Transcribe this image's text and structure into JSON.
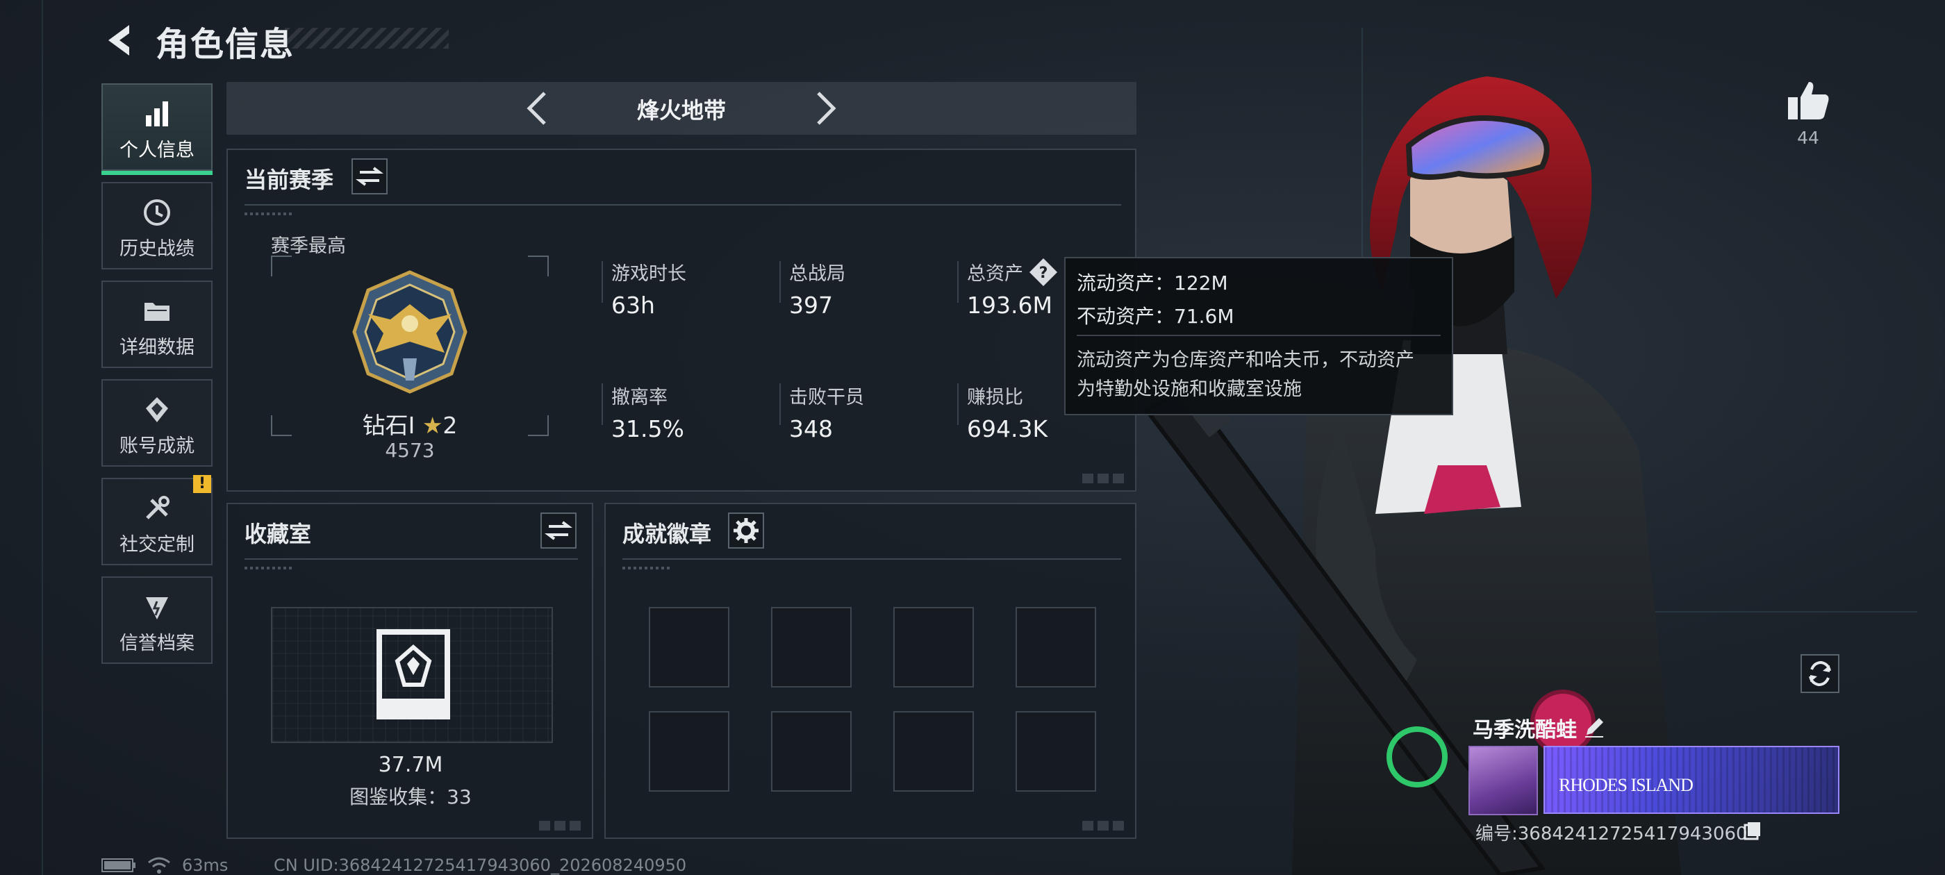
{
  "header": {
    "title": "角色信息"
  },
  "sidebar": {
    "items": [
      {
        "label": "个人信息",
        "icon": "bar-chart-icon",
        "active": true
      },
      {
        "label": "历史战绩",
        "icon": "history-icon",
        "active": false
      },
      {
        "label": "详细数据",
        "icon": "folder-icon",
        "active": false
      },
      {
        "label": "账号成就",
        "icon": "achievement-icon",
        "active": false
      },
      {
        "label": "社交定制",
        "icon": "tools-icon",
        "active": false,
        "badge": "!"
      },
      {
        "label": "信誉档案",
        "icon": "credit-icon",
        "active": false
      }
    ]
  },
  "mode": {
    "title": "烽火地带"
  },
  "season": {
    "title": "当前赛季",
    "best_label": "赛季最高",
    "rank_name": "钻石I",
    "rank_stars": "2",
    "rank_score": "4573",
    "stats": [
      {
        "label": "游戏时长",
        "value": "63h"
      },
      {
        "label": "总战局",
        "value": "397"
      },
      {
        "label": "总资产",
        "value": "193.6M"
      },
      {
        "label": "撤离率",
        "value": "31.5%"
      },
      {
        "label": "击败干员",
        "value": "348"
      },
      {
        "label": "赚损比",
        "value": "694.3K"
      }
    ]
  },
  "tooltip": {
    "liquid": "流动资产：122M",
    "fixed": "不动资产：71.6M",
    "desc_line1": "流动资产为仓库资产和哈夫币，不动资产",
    "desc_line2": "为特勤处设施和收藏室设施"
  },
  "collection": {
    "title": "收藏室",
    "value": "37.7M",
    "count": "图鉴收集：33"
  },
  "badges": {
    "title": "成就徽章",
    "slots": 8
  },
  "likes": {
    "count": "44"
  },
  "player": {
    "name": "马季洗酷蛙",
    "banner_text": "RHODES ISLAND",
    "uid": "编号:368424127254179430​60"
  },
  "status": {
    "ping": "63ms",
    "footer_uid": "CN UID:368424127254179430​60_202608240950"
  },
  "colors": {
    "accent": "#39d28e",
    "warning": "#f0b92b",
    "banner": "#5b4cf0"
  }
}
